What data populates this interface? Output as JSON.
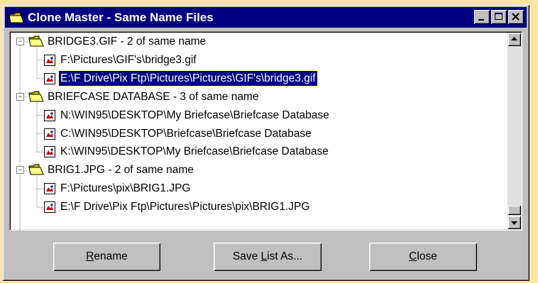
{
  "window": {
    "title": "Clone Master - Same Name Files"
  },
  "tree": {
    "groups": [
      {
        "label": "BRIDGE3.GIF - 2 of same name",
        "files": [
          {
            "label": "F:\\Pictures\\GIF's\\bridge3.gif",
            "selected": false
          },
          {
            "label": "E:\\F Drive\\Pix Ftp\\Pictures\\Pictures\\GIF's\\bridge3.gif",
            "selected": true
          }
        ]
      },
      {
        "label": "BRIEFCASE DATABASE - 3 of same name",
        "files": [
          {
            "label": "N:\\WIN95\\DESKTOP\\My Briefcase\\Briefcase Database",
            "selected": false
          },
          {
            "label": "C:\\WIN95\\DESKTOP\\Briefcase\\Briefcase Database",
            "selected": false
          },
          {
            "label": "K:\\WIN95\\DESKTOP\\My Briefcase\\Briefcase Database",
            "selected": false
          }
        ]
      },
      {
        "label": "BRIG1.JPG - 2 of same name",
        "files": [
          {
            "label": "F:\\Pictures\\pix\\BRIG1.JPG",
            "selected": false
          },
          {
            "label": "E:\\F Drive\\Pix Ftp\\Pictures\\Pictures\\pix\\BRIG1.JPG",
            "selected": false
          }
        ]
      }
    ]
  },
  "buttons": {
    "rename": {
      "mnemonic": "R",
      "rest": "ename"
    },
    "save": {
      "before": "Save ",
      "mnemonic": "L",
      "rest": "ist As..."
    },
    "close": {
      "mnemonic": "C",
      "rest": "lose"
    }
  },
  "icons": {
    "title": "folder-open-icon",
    "folder": "folder-open-icon",
    "file": "image-file-icon"
  },
  "colors": {
    "titlebar": "#000080",
    "selection": "#000080",
    "window": "#c0c0c0",
    "background": "#fde4a4"
  }
}
